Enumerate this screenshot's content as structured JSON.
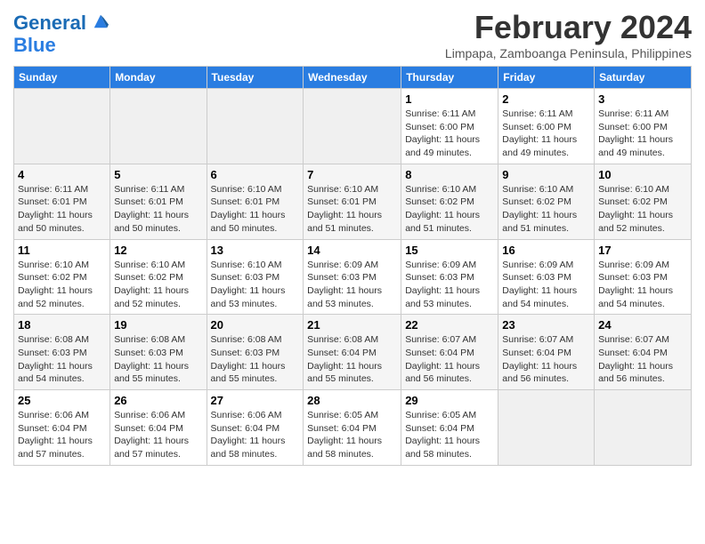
{
  "header": {
    "logo_line1": "General",
    "logo_line2": "Blue",
    "month": "February 2024",
    "location": "Limpapa, Zamboanga Peninsula, Philippines"
  },
  "days_of_week": [
    "Sunday",
    "Monday",
    "Tuesday",
    "Wednesday",
    "Thursday",
    "Friday",
    "Saturday"
  ],
  "weeks": [
    [
      {
        "day": "",
        "detail": ""
      },
      {
        "day": "",
        "detail": ""
      },
      {
        "day": "",
        "detail": ""
      },
      {
        "day": "",
        "detail": ""
      },
      {
        "day": "1",
        "detail": "Sunrise: 6:11 AM\nSunset: 6:00 PM\nDaylight: 11 hours\nand 49 minutes."
      },
      {
        "day": "2",
        "detail": "Sunrise: 6:11 AM\nSunset: 6:00 PM\nDaylight: 11 hours\nand 49 minutes."
      },
      {
        "day": "3",
        "detail": "Sunrise: 6:11 AM\nSunset: 6:00 PM\nDaylight: 11 hours\nand 49 minutes."
      }
    ],
    [
      {
        "day": "4",
        "detail": "Sunrise: 6:11 AM\nSunset: 6:01 PM\nDaylight: 11 hours\nand 50 minutes."
      },
      {
        "day": "5",
        "detail": "Sunrise: 6:11 AM\nSunset: 6:01 PM\nDaylight: 11 hours\nand 50 minutes."
      },
      {
        "day": "6",
        "detail": "Sunrise: 6:10 AM\nSunset: 6:01 PM\nDaylight: 11 hours\nand 50 minutes."
      },
      {
        "day": "7",
        "detail": "Sunrise: 6:10 AM\nSunset: 6:01 PM\nDaylight: 11 hours\nand 51 minutes."
      },
      {
        "day": "8",
        "detail": "Sunrise: 6:10 AM\nSunset: 6:02 PM\nDaylight: 11 hours\nand 51 minutes."
      },
      {
        "day": "9",
        "detail": "Sunrise: 6:10 AM\nSunset: 6:02 PM\nDaylight: 11 hours\nand 51 minutes."
      },
      {
        "day": "10",
        "detail": "Sunrise: 6:10 AM\nSunset: 6:02 PM\nDaylight: 11 hours\nand 52 minutes."
      }
    ],
    [
      {
        "day": "11",
        "detail": "Sunrise: 6:10 AM\nSunset: 6:02 PM\nDaylight: 11 hours\nand 52 minutes."
      },
      {
        "day": "12",
        "detail": "Sunrise: 6:10 AM\nSunset: 6:02 PM\nDaylight: 11 hours\nand 52 minutes."
      },
      {
        "day": "13",
        "detail": "Sunrise: 6:10 AM\nSunset: 6:03 PM\nDaylight: 11 hours\nand 53 minutes."
      },
      {
        "day": "14",
        "detail": "Sunrise: 6:09 AM\nSunset: 6:03 PM\nDaylight: 11 hours\nand 53 minutes."
      },
      {
        "day": "15",
        "detail": "Sunrise: 6:09 AM\nSunset: 6:03 PM\nDaylight: 11 hours\nand 53 minutes."
      },
      {
        "day": "16",
        "detail": "Sunrise: 6:09 AM\nSunset: 6:03 PM\nDaylight: 11 hours\nand 54 minutes."
      },
      {
        "day": "17",
        "detail": "Sunrise: 6:09 AM\nSunset: 6:03 PM\nDaylight: 11 hours\nand 54 minutes."
      }
    ],
    [
      {
        "day": "18",
        "detail": "Sunrise: 6:08 AM\nSunset: 6:03 PM\nDaylight: 11 hours\nand 54 minutes."
      },
      {
        "day": "19",
        "detail": "Sunrise: 6:08 AM\nSunset: 6:03 PM\nDaylight: 11 hours\nand 55 minutes."
      },
      {
        "day": "20",
        "detail": "Sunrise: 6:08 AM\nSunset: 6:03 PM\nDaylight: 11 hours\nand 55 minutes."
      },
      {
        "day": "21",
        "detail": "Sunrise: 6:08 AM\nSunset: 6:04 PM\nDaylight: 11 hours\nand 55 minutes."
      },
      {
        "day": "22",
        "detail": "Sunrise: 6:07 AM\nSunset: 6:04 PM\nDaylight: 11 hours\nand 56 minutes."
      },
      {
        "day": "23",
        "detail": "Sunrise: 6:07 AM\nSunset: 6:04 PM\nDaylight: 11 hours\nand 56 minutes."
      },
      {
        "day": "24",
        "detail": "Sunrise: 6:07 AM\nSunset: 6:04 PM\nDaylight: 11 hours\nand 56 minutes."
      }
    ],
    [
      {
        "day": "25",
        "detail": "Sunrise: 6:06 AM\nSunset: 6:04 PM\nDaylight: 11 hours\nand 57 minutes."
      },
      {
        "day": "26",
        "detail": "Sunrise: 6:06 AM\nSunset: 6:04 PM\nDaylight: 11 hours\nand 57 minutes."
      },
      {
        "day": "27",
        "detail": "Sunrise: 6:06 AM\nSunset: 6:04 PM\nDaylight: 11 hours\nand 58 minutes."
      },
      {
        "day": "28",
        "detail": "Sunrise: 6:05 AM\nSunset: 6:04 PM\nDaylight: 11 hours\nand 58 minutes."
      },
      {
        "day": "29",
        "detail": "Sunrise: 6:05 AM\nSunset: 6:04 PM\nDaylight: 11 hours\nand 58 minutes."
      },
      {
        "day": "",
        "detail": ""
      },
      {
        "day": "",
        "detail": ""
      }
    ]
  ]
}
